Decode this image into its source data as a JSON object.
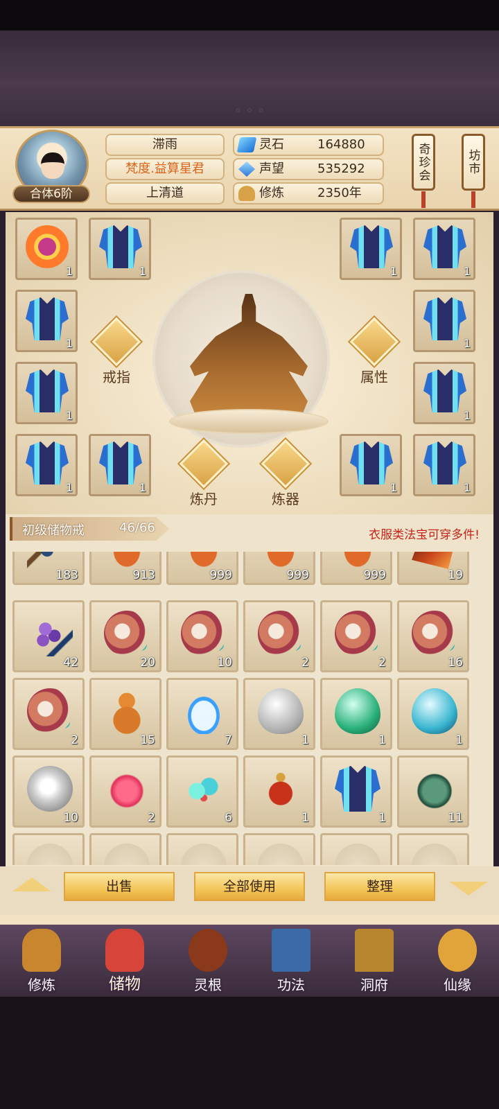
{
  "header": {
    "rank": "合体6阶",
    "name": "滞雨",
    "title": "梵度.益算星君",
    "sect": "上清道",
    "stats": [
      {
        "icon": "spirit-stone-icon",
        "label": "灵石",
        "value": "164880"
      },
      {
        "icon": "reputation-icon",
        "label": "声望",
        "value": "535292"
      },
      {
        "icon": "cultivation-icon",
        "label": "修炼",
        "value": "2350年"
      }
    ],
    "side_buttons": [
      "奇珍会",
      "坊市"
    ]
  },
  "equipment": {
    "slots": [
      {
        "item": "ring",
        "qty": "1"
      },
      {
        "item": "armor",
        "qty": "1"
      },
      {
        "item": "armor",
        "qty": "1"
      },
      {
        "item": "armor",
        "qty": "1"
      },
      {
        "item": "armor",
        "qty": "1"
      },
      {
        "item": "armor",
        "qty": "1"
      },
      {
        "item": "armor",
        "qty": "1"
      },
      {
        "item": "armor",
        "qty": "1"
      },
      {
        "item": "armor",
        "qty": "1"
      },
      {
        "item": "armor",
        "qty": "1"
      },
      {
        "item": "armor",
        "qty": "1"
      },
      {
        "item": "armor",
        "qty": "1"
      }
    ],
    "actions": {
      "ring": "戒指",
      "attributes": "属性",
      "alchemy": "炼丹",
      "forge": "炼器"
    }
  },
  "storage": {
    "ring_name": "初级储物戒",
    "capacity": "46/66",
    "hint": "衣服类法宝可穿多件!",
    "rows": [
      [
        {
          "item": "branch",
          "qty": "183"
        },
        {
          "item": "worm",
          "qty": "913"
        },
        {
          "item": "worm",
          "qty": "999"
        },
        {
          "item": "worm",
          "qty": "999"
        },
        {
          "item": "worm",
          "qty": "999"
        },
        {
          "item": "crystal",
          "qty": "19"
        }
      ],
      [
        {
          "item": "grapes",
          "qty": "42"
        },
        {
          "item": "snail",
          "qty": "20"
        },
        {
          "item": "snail",
          "qty": "10"
        },
        {
          "item": "snail",
          "qty": "2"
        },
        {
          "item": "snail",
          "qty": "2"
        },
        {
          "item": "snail",
          "qty": "16"
        }
      ],
      [
        {
          "item": "snail",
          "qty": "2"
        },
        {
          "item": "gourd",
          "qty": "15"
        },
        {
          "item": "bowl",
          "qty": "7"
        },
        {
          "item": "egg-w",
          "qty": "1"
        },
        {
          "item": "egg-g",
          "qty": "1"
        },
        {
          "item": "egg-c",
          "qty": "1"
        }
      ],
      [
        {
          "item": "pearl",
          "qty": "10"
        },
        {
          "item": "lotus",
          "qty": "2"
        },
        {
          "item": "cloud",
          "qty": "6"
        },
        {
          "item": "teapot",
          "qty": "1"
        },
        {
          "item": "armor",
          "qty": "1"
        },
        {
          "item": "jade",
          "qty": "11"
        }
      ],
      [
        {
          "item": "blank",
          "qty": ""
        },
        {
          "item": "blank",
          "qty": ""
        },
        {
          "item": "blank",
          "qty": ""
        },
        {
          "item": "blank",
          "qty": ""
        },
        {
          "item": "blank",
          "qty": ""
        },
        {
          "item": "blank",
          "qty": ""
        }
      ]
    ],
    "buttons": {
      "sell": "出售",
      "use_all": "全部使用",
      "sort": "整理"
    }
  },
  "nav": [
    {
      "label": "修炼",
      "icon": "meditating-monk-icon",
      "color": "#c8872e"
    },
    {
      "label": "储物",
      "icon": "storage-bag-icon",
      "color": "#d6443a",
      "active": true
    },
    {
      "label": "灵根",
      "icon": "spirit-root-icon",
      "color": "#8a3a1a"
    },
    {
      "label": "功法",
      "icon": "technique-book-icon",
      "color": "#3a6aa8"
    },
    {
      "label": "洞府",
      "icon": "cave-house-icon",
      "color": "#b8862e"
    },
    {
      "label": "仙缘",
      "icon": "immortal-gourd-icon",
      "color": "#e0a43a"
    }
  ]
}
